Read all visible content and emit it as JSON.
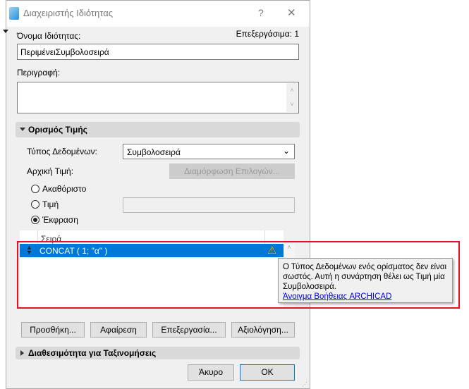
{
  "window": {
    "title": "Διαχειριστής Ιδιότητας",
    "help": "?",
    "close": "✕"
  },
  "name_label": "Όνομα Ιδιότητας:",
  "editable": "Επεξεργάσιμα: 1",
  "name_value": "ΠεριμένειΣυμβολοσειρά",
  "description_label": "Περιγραφή:",
  "description_value": "",
  "section_value": "Ορισμός Τιμής",
  "data_type_label": "Τύπος Δεδομένων:",
  "data_type_value": "Συμβολοσειρά",
  "default_label": "Αρχική Τιμή:",
  "configure_button": "Διαμόρφωση Επιλογών...",
  "radios": [
    {
      "label": "Ακαθόριστο",
      "checked": false
    },
    {
      "label": "Τιμή",
      "checked": false
    },
    {
      "label": "Έκφραση",
      "checked": true
    }
  ],
  "list": {
    "header": "Σειρά",
    "rows": [
      {
        "expr": "CONCAT ( 1; \"α\" )",
        "warning": true
      }
    ]
  },
  "tooltip": {
    "text": "Ο Τύπος Δεδομένων ενός ορίσματος δεν είναι σωστός. Αυτή η συνάρτηση θέλει ως Τιμή μία Συμβολοσειρά.",
    "link": "Άνοιγμα Βοήθειας ARCHICAD"
  },
  "buttons": {
    "add": "Προσθήκη...",
    "remove": "Αφαίρεση",
    "edit": "Επεξεργασία...",
    "evaluate": "Αξιολόγηση..."
  },
  "section_availability": "Διαθεσιμότητα για Ταξινομήσεις",
  "footer": {
    "cancel": "Άκυρο",
    "ok": "OK"
  },
  "colors": {
    "selection": "#0078d7",
    "highlight": "#e81123",
    "link": "#0000ee"
  }
}
